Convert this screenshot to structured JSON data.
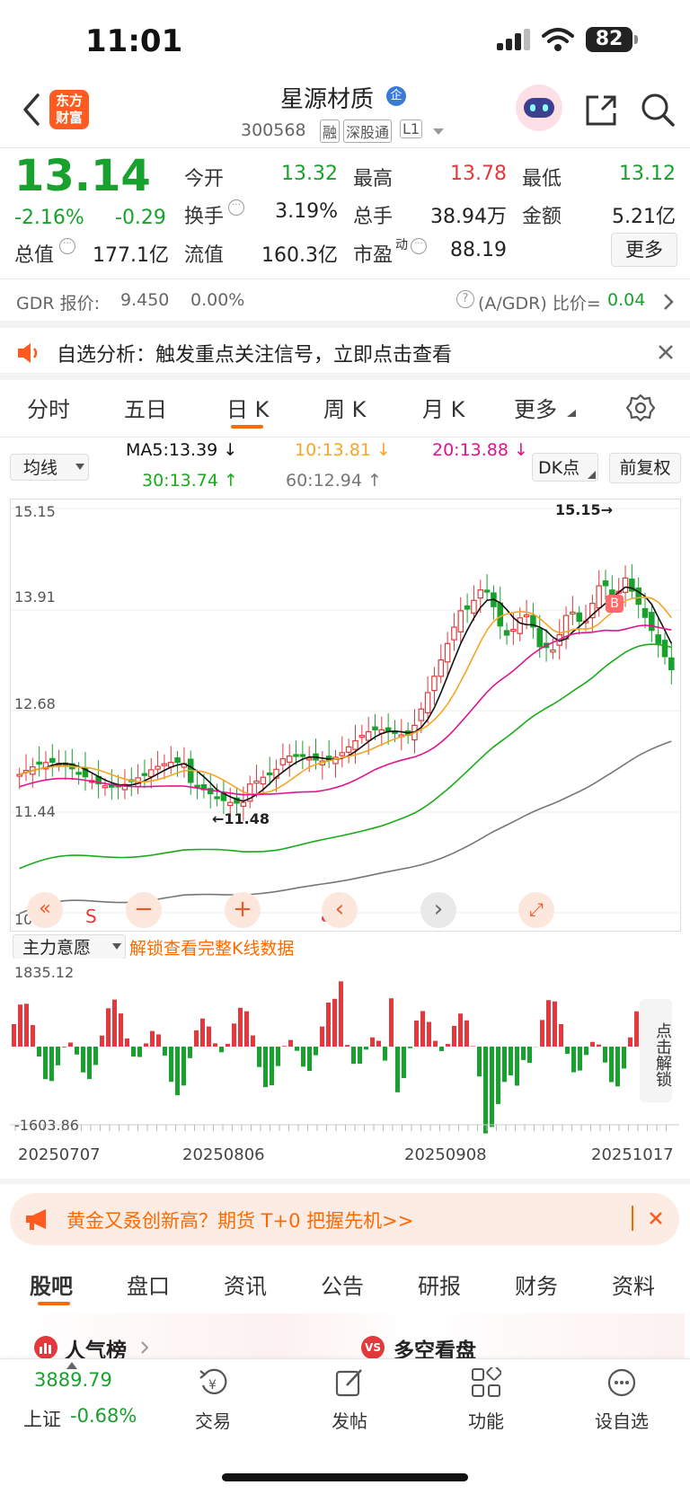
{
  "status_bar": {
    "time": "11:01",
    "battery": "82"
  },
  "header": {
    "logo_line1": "东方",
    "logo_line2": "财富",
    "stock_name": "星源材质",
    "stock_badge": "企",
    "code": "300568",
    "tags": [
      "融",
      "深股通",
      "L1"
    ]
  },
  "quote": {
    "price": "13.14",
    "change_pct": "-2.16%",
    "change_amt": "-0.29",
    "open_label": "今开",
    "open": "13.32",
    "high_label": "最高",
    "high": "13.78",
    "low_label": "最低",
    "low": "13.12",
    "turnover_label": "换手",
    "turnover": "3.19%",
    "volume_label": "总手",
    "volume": "38.94万",
    "amount_label": "金额",
    "amount": "5.21亿",
    "mktcap_label": "总值",
    "mktcap": "177.1亿",
    "float_label": "流值",
    "float": "160.3亿",
    "pe_label": "市盈",
    "pe_sup": "动",
    "pe": "88.19",
    "more_label": "更多"
  },
  "gdr": {
    "label": "GDR 报价:",
    "price": "9.450",
    "pct": "0.00%",
    "ratio_label": "(A/GDR) 比价=",
    "ratio": "0.04"
  },
  "notice": {
    "text": "自选分析：触发重点关注信号，立即点击查看"
  },
  "tabs": [
    "分时",
    "五日",
    "日 K",
    "周 K",
    "月 K",
    "更多"
  ],
  "active_tab": "日 K",
  "ma": {
    "selector": "均线",
    "ma5": "MA5:13.39",
    "ma10": "10:13.81",
    "ma20": "20:13.88",
    "ma30": "30:13.74",
    "ma60": "60:12.94",
    "dk_label": "DK点",
    "adjust_label": "前复权",
    "colors": {
      "ma5": "#111111",
      "ma10": "#f5a623",
      "ma20": "#e0148c",
      "ma30": "#1aab1a",
      "ma60": "#777777"
    }
  },
  "chart_data": {
    "type": "candlestick",
    "y_ticks": [
      "15.15",
      "13.91",
      "12.68",
      "11.44",
      "10.21"
    ],
    "ylim": [
      10.21,
      15.15
    ],
    "annotations": {
      "max": "15.15",
      "min": "11.48",
      "buy_marker": "B",
      "sell_marker": "S"
    },
    "indicator_label": "主力意愿",
    "unlock_text": "解锁查看完整K线数据",
    "volume_ticks": [
      "1835.12",
      "-1603.86"
    ],
    "x_ticks": [
      "20250707",
      "20250806",
      "20250908",
      "20251017"
    ],
    "side_unlock": "点击解锁"
  },
  "ad": {
    "text": "黄金又叒创新高？期货 T+0 把握先机>>"
  },
  "bottom_tabs": [
    "股吧",
    "盘口",
    "资讯",
    "公告",
    "研报",
    "财务",
    "资料"
  ],
  "active_bottom_tab": "股吧",
  "section": {
    "popular": "人气榜",
    "longshort": "多空看盘"
  },
  "dock": {
    "index_value": "3889.79",
    "index_name": "上证",
    "index_change": "-0.68%",
    "trade": "交易",
    "post": "发帖",
    "func": "功能",
    "watch": "设自选"
  }
}
